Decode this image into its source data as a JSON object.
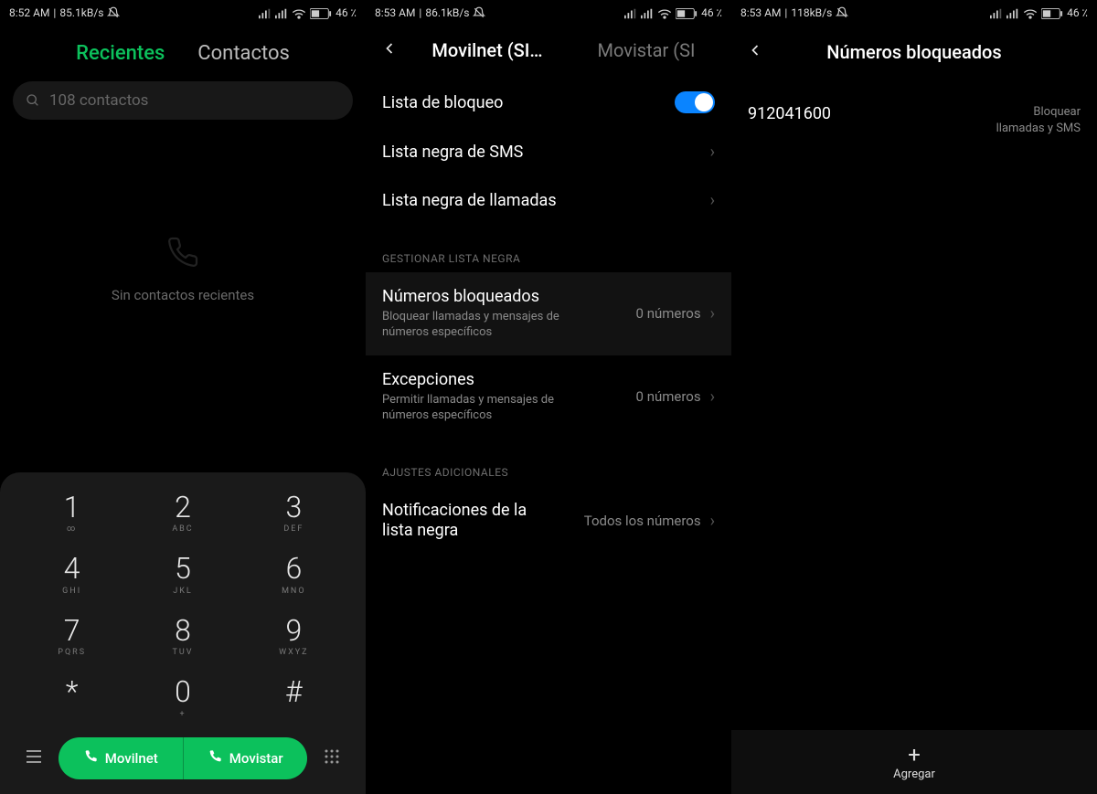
{
  "panel1": {
    "status": {
      "time": "8:52 AM",
      "net": "85.1kB/s",
      "battery": "46"
    },
    "tabs": {
      "recent": "Recientes",
      "contacts": "Contactos"
    },
    "search_placeholder": "108 contactos",
    "empty_text": "Sin contactos recientes",
    "keys": [
      {
        "d": "1",
        "l": "∞"
      },
      {
        "d": "2",
        "l": "ABC"
      },
      {
        "d": "3",
        "l": "DEF"
      },
      {
        "d": "4",
        "l": "GHI"
      },
      {
        "d": "5",
        "l": "JKL"
      },
      {
        "d": "6",
        "l": "MNO"
      },
      {
        "d": "7",
        "l": "PQRS"
      },
      {
        "d": "8",
        "l": "TUV"
      },
      {
        "d": "9",
        "l": "WXYZ"
      },
      {
        "d": "*",
        "l": ""
      },
      {
        "d": "0",
        "l": "+"
      },
      {
        "d": "#",
        "l": ""
      }
    ],
    "sim1_label": "Movilnet",
    "sim2_label": "Movistar"
  },
  "panel2": {
    "status": {
      "time": "8:53 AM",
      "net": "86.1kB/s",
      "battery": "46"
    },
    "sim_tab1": "Movilnet (SI…",
    "sim_tab2": "Movistar (SI",
    "rows": {
      "blocklist": "Lista de bloqueo",
      "sms_blacklist": "Lista negra de SMS",
      "call_blacklist": "Lista negra de llamadas"
    },
    "section1": "GESTIONAR LISTA NEGRA",
    "blocked_numbers": {
      "title": "Números bloqueados",
      "sub": "Bloquear llamadas y mensajes de números específicos",
      "value": "0 números"
    },
    "exceptions": {
      "title": "Excepciones",
      "sub": "Permitir llamadas y mensajes de números específicos",
      "value": "0 números"
    },
    "section2": "AJUSTES ADICIONALES",
    "notif": {
      "title": "Notificaciones de la lista negra",
      "value": "Todos los números"
    }
  },
  "panel3": {
    "status": {
      "time": "8:53 AM",
      "net": "118kB/s",
      "battery": "46"
    },
    "title": "Números bloqueados",
    "entry": {
      "number": "912041600",
      "desc": "Bloquear llamadas y SMS"
    },
    "add_label": "Agregar"
  }
}
